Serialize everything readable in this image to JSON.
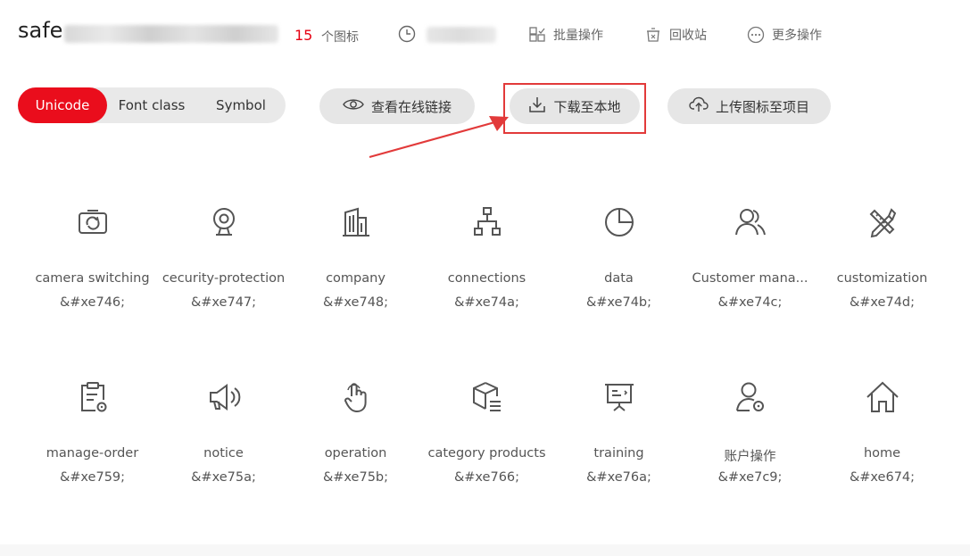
{
  "header": {
    "project_name": "safe",
    "icon_count": "15",
    "icon_count_label": "个图标",
    "actions": [
      {
        "label": "批量操作",
        "icon": "batch-icon"
      },
      {
        "label": "回收站",
        "icon": "trash-icon"
      },
      {
        "label": "更多操作",
        "icon": "more-icon"
      }
    ]
  },
  "toolbar": {
    "tabs": [
      {
        "label": "Unicode",
        "active": true
      },
      {
        "label": "Font class",
        "active": false
      },
      {
        "label": "Symbol",
        "active": false
      }
    ],
    "view_link_label": "查看在线链接",
    "download_label": "下载至本地",
    "upload_label": "上传图标至项目"
  },
  "icons": [
    {
      "name": "camera switching",
      "code": "&#xe746;",
      "icon": "camera-switch-icon"
    },
    {
      "name": "cecurity-protection",
      "code": "&#xe747;",
      "icon": "security-camera-icon"
    },
    {
      "name": "company",
      "code": "&#xe748;",
      "icon": "building-icon"
    },
    {
      "name": "connections",
      "code": "&#xe74a;",
      "icon": "hierarchy-icon"
    },
    {
      "name": "data",
      "code": "&#xe74b;",
      "icon": "pie-chart-icon"
    },
    {
      "name": "Customer mana...",
      "code": "&#xe74c;",
      "icon": "users-icon"
    },
    {
      "name": "customization",
      "code": "&#xe74d;",
      "icon": "tools-icon"
    },
    {
      "name": "manage-order",
      "code": "&#xe759;",
      "icon": "clipboard-settings-icon"
    },
    {
      "name": "notice",
      "code": "&#xe75a;",
      "icon": "megaphone-icon"
    },
    {
      "name": "operation",
      "code": "&#xe75b;",
      "icon": "touch-icon"
    },
    {
      "name": "category products",
      "code": "&#xe766;",
      "icon": "box-list-icon"
    },
    {
      "name": "training",
      "code": "&#xe76a;",
      "icon": "presentation-icon"
    },
    {
      "name": "账户操作",
      "code": "&#xe7c9;",
      "icon": "user-settings-icon"
    },
    {
      "name": "home",
      "code": "&#xe674;",
      "icon": "home-icon"
    }
  ],
  "colors": {
    "accent": "#ea0d1c",
    "annotation": "#e23a3a",
    "icon_stroke": "#555555"
  }
}
